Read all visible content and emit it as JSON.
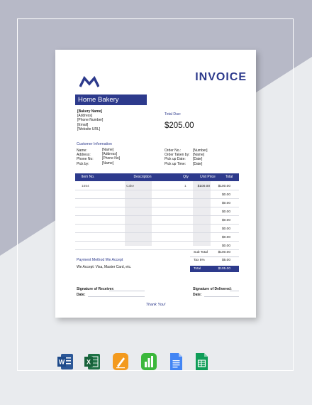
{
  "invoice": {
    "title": "INVOICE",
    "company_name": "Home Bakery",
    "company_details": [
      "[Bakery Name]",
      "[Address]",
      "[Phone Number]",
      "[Email]",
      "[Website URL]"
    ],
    "total_due_label": "Total Due:",
    "total_due_amount": "$205.00",
    "customer_section_title": "Customer Information",
    "customer_fields": [
      {
        "label": "Name:",
        "value": "[Name]"
      },
      {
        "label": "Address:",
        "value": "[Address]"
      },
      {
        "label": "Phone No:",
        "value": "[Phone No]"
      },
      {
        "label": "Pick by:",
        "value": "[Name]"
      }
    ],
    "order_fields": [
      {
        "label": "Order No.:",
        "value": "[Number]"
      },
      {
        "label": "Order Taken by:",
        "value": "[Name]"
      },
      {
        "label": "Pick up Date:",
        "value": "[Date]"
      },
      {
        "label": "Pick up Time:",
        "value": "[Date]"
      }
    ],
    "table_headers": [
      "Item No.",
      "Description",
      "Qty",
      "Unit Price",
      "Total"
    ],
    "rows": [
      {
        "item": "1554",
        "desc": "Cake",
        "qty": "1",
        "unit": "$100.00",
        "total": "$100.00"
      },
      {
        "item": "",
        "desc": "",
        "qty": "",
        "unit": "",
        "total": "$0.00"
      },
      {
        "item": "",
        "desc": "",
        "qty": "",
        "unit": "",
        "total": "$0.00"
      },
      {
        "item": "",
        "desc": "",
        "qty": "",
        "unit": "",
        "total": "$0.00"
      },
      {
        "item": "",
        "desc": "",
        "qty": "",
        "unit": "",
        "total": "$0.00"
      },
      {
        "item": "",
        "desc": "",
        "qty": "",
        "unit": "",
        "total": "$0.00"
      },
      {
        "item": "",
        "desc": "",
        "qty": "",
        "unit": "",
        "total": "$0.00"
      },
      {
        "item": "",
        "desc": "",
        "qty": "",
        "unit": "",
        "total": "$0.00"
      }
    ],
    "subtotal_label": "Sub Total",
    "subtotal_value": "$100.00",
    "tax_label": "Tax 5%",
    "tax_value": "$5.00",
    "total_label": "Total",
    "total_value": "$105.00",
    "payment_title": "Payment Method We Accept",
    "payment_text": "We Accept: Visa, Master Card, etc.",
    "sig_receiver_label": "Signature of Receiver:",
    "sig_delivered_label": "Signature of Delivered:",
    "date_label": "Date:",
    "date_label_2": "Date:",
    "thank_you": "Thank You!"
  },
  "app_icons": [
    "word-icon",
    "excel-icon",
    "pages-icon",
    "numbers-icon",
    "google-docs-icon",
    "google-sheets-icon"
  ],
  "colors": {
    "accent": "#2d3a8c",
    "background": "#e9ebee"
  }
}
